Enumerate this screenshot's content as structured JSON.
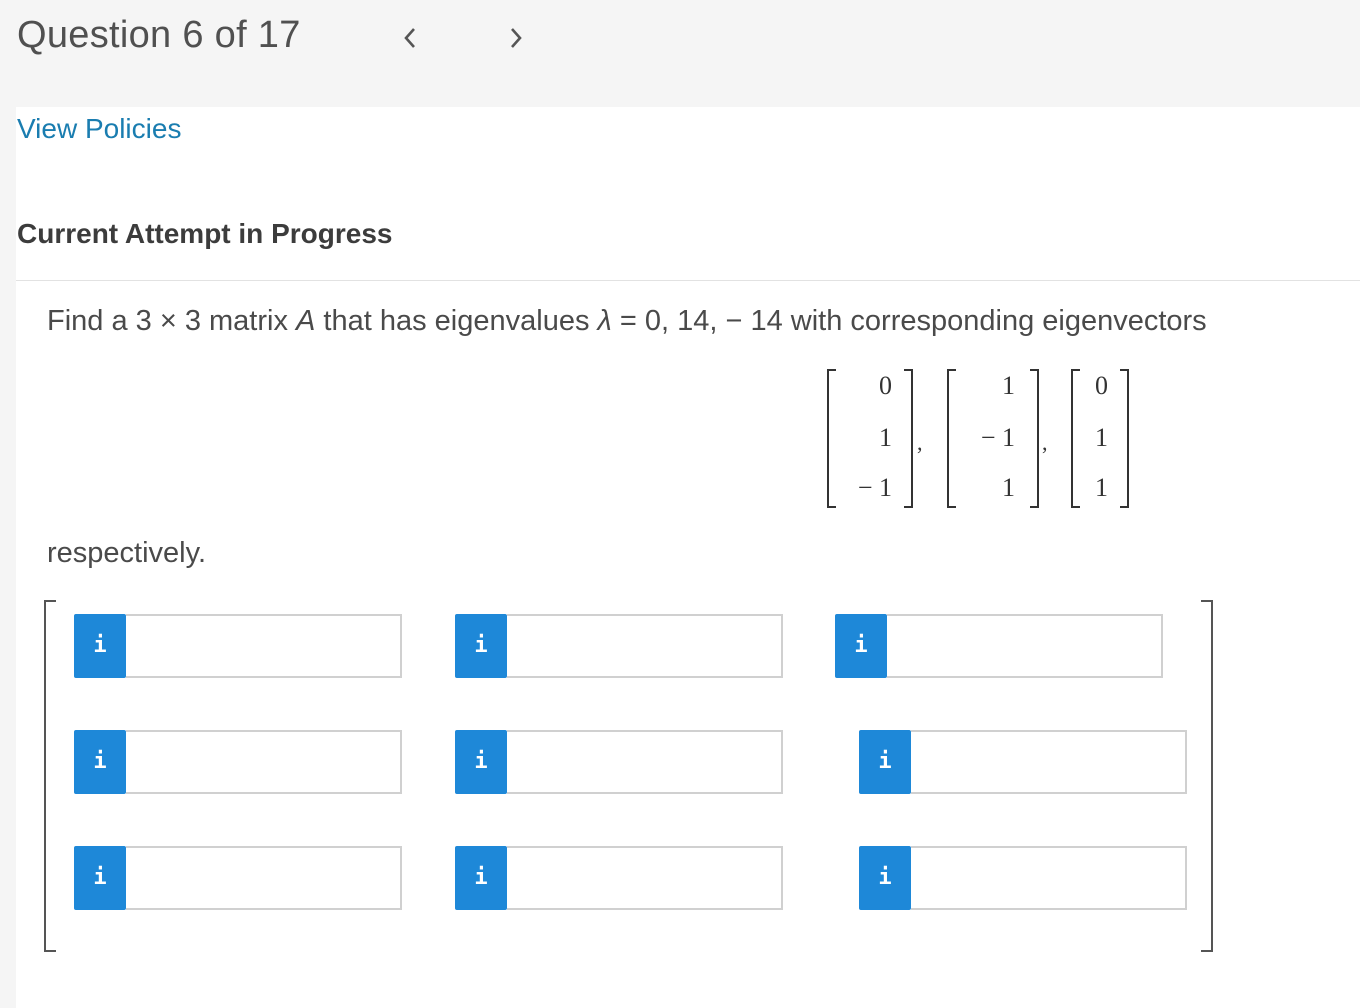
{
  "header": {
    "question_label": "Question 6 of 17",
    "prev_glyph": "<",
    "next_glyph": ">"
  },
  "links": {
    "view_policies": "View Policies"
  },
  "status": {
    "attempt": "Current Attempt in Progress"
  },
  "problem": {
    "text_before_A": "Find a 3 × 3 matrix ",
    "matrix_symbol": "A",
    "text_mid": " that has eigenvalues ",
    "lambda": "λ",
    "text_after": " = 0, 14, − 14 with corresponding eigenvectors",
    "eigenvectors": [
      [
        "0",
        "1",
        "− 1"
      ],
      [
        "1",
        "− 1",
        "1"
      ],
      [
        "0",
        "1",
        "1"
      ]
    ],
    "separator": ",",
    "closing": "respectively."
  },
  "answer_grid": {
    "info_glyph": "i",
    "cells": [
      [
        "",
        "",
        ""
      ],
      [
        "",
        "",
        ""
      ],
      [
        "",
        "",
        ""
      ]
    ]
  },
  "colors": {
    "info_button": "#1e88d8",
    "link": "#1a7db0",
    "header_bg": "#f5f5f5"
  }
}
